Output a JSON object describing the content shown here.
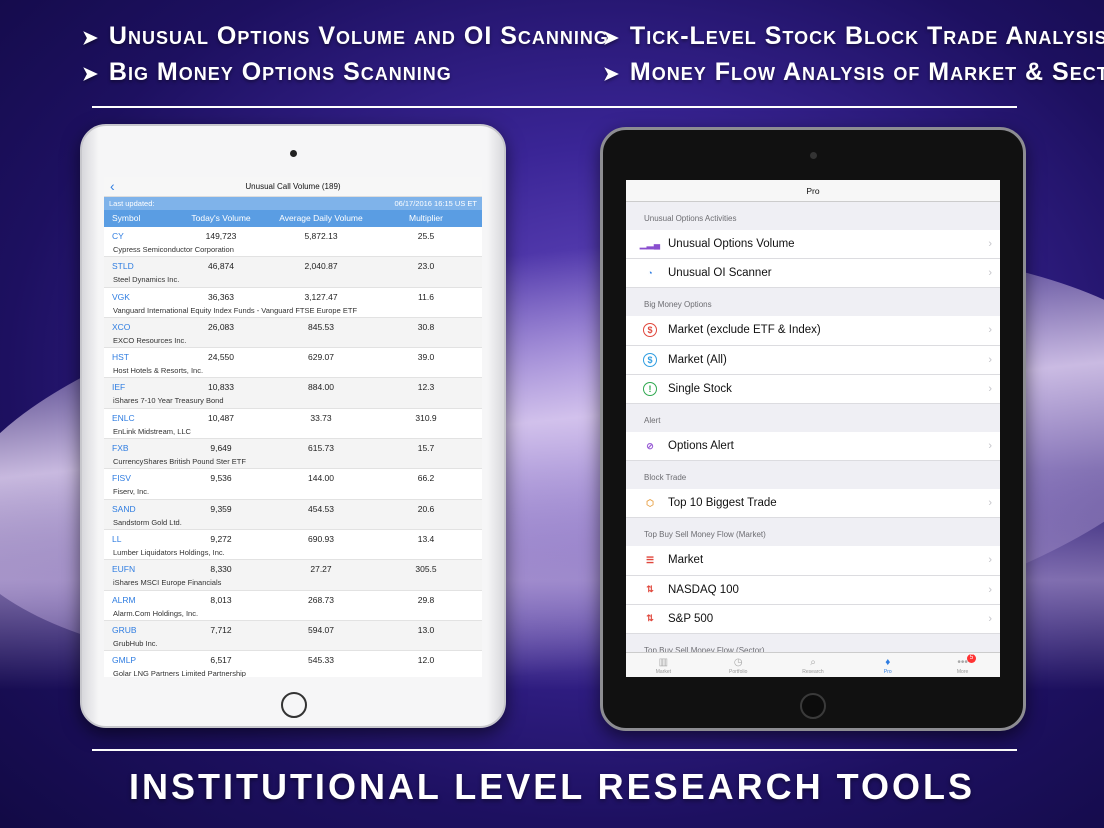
{
  "headlines": {
    "tl1": "Unusual Options Volume and OI Scanning",
    "tl2": "Big Money Options Scanning",
    "tr1": "Tick-Level Stock Block Trade Analysis",
    "tr2": "Money Flow Analysis of Market & Sectors",
    "arrow": "➤"
  },
  "footer": "INSTITUTIONAL LEVEL RESEARCH TOOLS",
  "left": {
    "title": "Unusual Call Volume  (189)",
    "back": "‹",
    "updated_label": "Last updated:",
    "updated_value": "06/17/2016  16:15 US ET",
    "columns": [
      "Symbol",
      "Today's Volume",
      "Average Daily Volume",
      "Multiplier"
    ],
    "rows": [
      {
        "symbol": "CY",
        "volume": "149,723",
        "avg": "5,872.13",
        "mult": "25.5",
        "name": "Cypress Semiconductor Corporation"
      },
      {
        "symbol": "STLD",
        "volume": "46,874",
        "avg": "2,040.87",
        "mult": "23.0",
        "name": "Steel Dynamics Inc."
      },
      {
        "symbol": "VGK",
        "volume": "36,363",
        "avg": "3,127.47",
        "mult": "11.6",
        "name": "Vanguard International Equity Index Funds - Vanguard FTSE Europe ETF"
      },
      {
        "symbol": "XCO",
        "volume": "26,083",
        "avg": "845.53",
        "mult": "30.8",
        "name": "EXCO Resources Inc."
      },
      {
        "symbol": "HST",
        "volume": "24,550",
        "avg": "629.07",
        "mult": "39.0",
        "name": "Host Hotels & Resorts, Inc."
      },
      {
        "symbol": "IEF",
        "volume": "10,833",
        "avg": "884.00",
        "mult": "12.3",
        "name": "iShares 7-10 Year Treasury Bond"
      },
      {
        "symbol": "ENLC",
        "volume": "10,487",
        "avg": "33.73",
        "mult": "310.9",
        "name": "EnLink Midstream, LLC"
      },
      {
        "symbol": "FXB",
        "volume": "9,649",
        "avg": "615.73",
        "mult": "15.7",
        "name": "CurrencyShares British Pound Ster ETF"
      },
      {
        "symbol": "FISV",
        "volume": "9,536",
        "avg": "144.00",
        "mult": "66.2",
        "name": "Fiserv, Inc."
      },
      {
        "symbol": "SAND",
        "volume": "9,359",
        "avg": "454.53",
        "mult": "20.6",
        "name": "Sandstorm Gold Ltd."
      },
      {
        "symbol": "LL",
        "volume": "9,272",
        "avg": "690.93",
        "mult": "13.4",
        "name": "Lumber Liquidators Holdings, Inc."
      },
      {
        "symbol": "EUFN",
        "volume": "8,330",
        "avg": "27.27",
        "mult": "305.5",
        "name": "iShares MSCI Europe Financials"
      },
      {
        "symbol": "ALRM",
        "volume": "8,013",
        "avg": "268.73",
        "mult": "29.8",
        "name": "Alarm.Com Holdings, Inc."
      },
      {
        "symbol": "GRUB",
        "volume": "7,712",
        "avg": "594.07",
        "mult": "13.0",
        "name": "GrubHub Inc."
      },
      {
        "symbol": "GMLP",
        "volume": "6,517",
        "avg": "545.33",
        "mult": "12.0",
        "name": "Golar LNG Partners Limited Partnership"
      }
    ]
  },
  "right": {
    "title": "Pro",
    "sections": [
      {
        "header": "Unusual Options Activities",
        "items": [
          {
            "label": "Unusual Options Volume",
            "icon": "bar-chart-icon",
            "glyph": "▁▂▄",
            "color": "#8a4fcf"
          },
          {
            "label": "Unusual OI Scanner",
            "icon": "pie-chart-icon",
            "glyph": "◔",
            "color": "#2f7de1"
          }
        ]
      },
      {
        "header": "Big Money Options",
        "items": [
          {
            "label": "Market (exclude ETF & Index)",
            "icon": "dollar-red-icon",
            "glyph": "$",
            "color": "#e0473c"
          },
          {
            "label": "Market (All)",
            "icon": "dollar-blue-icon",
            "glyph": "$",
            "color": "#2f9de1"
          },
          {
            "label": "Single Stock",
            "icon": "info-green-icon",
            "glyph": "!",
            "color": "#2fa84f"
          }
        ]
      },
      {
        "header": "Alert",
        "items": [
          {
            "label": "Options Alert",
            "icon": "alert-off-icon",
            "glyph": "⊘",
            "color": "#9a5fd6"
          }
        ]
      },
      {
        "header": "Block Trade",
        "items": [
          {
            "label": "Top 10 Biggest Trade",
            "icon": "box-icon",
            "glyph": "⬡",
            "color": "#e8a34a"
          }
        ]
      },
      {
        "header": "Top Buy Sell Money Flow (Market)",
        "items": [
          {
            "label": "Market",
            "icon": "list-icon",
            "glyph": "☰",
            "color": "#e0473c"
          },
          {
            "label": "NASDAQ 100",
            "icon": "up-down-arrows-icon",
            "glyph": "⇅",
            "color": "#e0473c"
          },
          {
            "label": "S&P 500",
            "icon": "up-down-arrows-icon",
            "glyph": "⇅",
            "color": "#e0473c"
          }
        ]
      },
      {
        "header": "Top Buy Sell Money Flow (Sector)",
        "items": []
      }
    ],
    "tabs": [
      {
        "label": "Market",
        "glyph": "▥",
        "icon": "market-tab-icon"
      },
      {
        "label": "Portfolio",
        "glyph": "◷",
        "icon": "portfolio-tab-icon"
      },
      {
        "label": "Research",
        "glyph": "⌕",
        "icon": "research-tab-icon"
      },
      {
        "label": "Pro",
        "glyph": "♦",
        "icon": "pro-tab-icon",
        "active": true
      },
      {
        "label": "More",
        "glyph": "•••",
        "icon": "more-tab-icon",
        "badge": "5"
      }
    ],
    "chevron": "›"
  }
}
